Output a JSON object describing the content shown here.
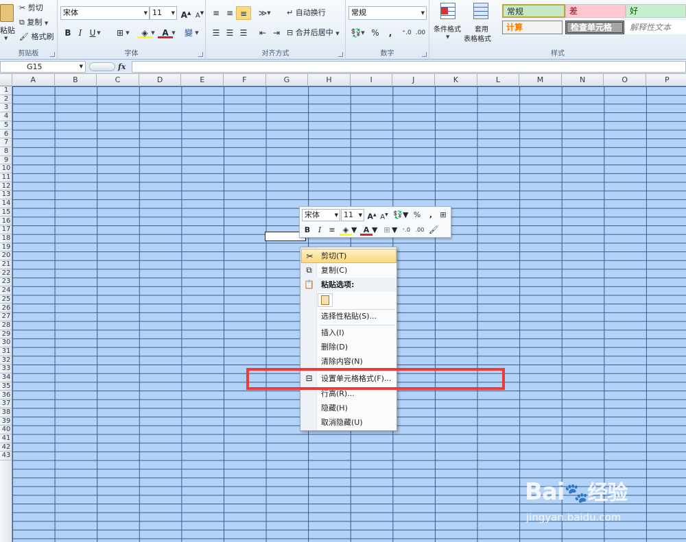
{
  "clipboard": {
    "paste_label": "粘贴",
    "cut_label": "剪切",
    "copy_label": "复制",
    "format_painter_label": "格式刷",
    "group_title": "剪贴板"
  },
  "font": {
    "font_name": "宋体",
    "font_size": "11",
    "group_title": "字体"
  },
  "alignment": {
    "wrap_text_label": "自动换行",
    "merge_center_label": "合并后居中",
    "group_title": "对齐方式"
  },
  "number": {
    "format_value": "常规",
    "group_title": "数字"
  },
  "styles": {
    "conditional_format_label": "条件格式",
    "table_format_label_1": "套用",
    "table_format_label_2": "表格格式",
    "group_title": "样式",
    "gallery": [
      {
        "label": "常规"
      },
      {
        "label": "差"
      },
      {
        "label": "好"
      },
      {
        "label": "计算"
      },
      {
        "label": "检查单元格"
      },
      {
        "label": "解释性文本"
      }
    ]
  },
  "formula_bar": {
    "name_box": "G15",
    "fx_label": "fx"
  },
  "columns": [
    "A",
    "B",
    "C",
    "D",
    "E",
    "F",
    "G",
    "H",
    "I",
    "J",
    "K",
    "L",
    "M",
    "N",
    "O",
    "P"
  ],
  "rows": [
    "1",
    "2",
    "3",
    "4",
    "5",
    "6",
    "7",
    "8",
    "9",
    "10",
    "11",
    "12",
    "13",
    "14",
    "15",
    "16",
    "17",
    "18",
    "19",
    "20",
    "21",
    "22",
    "23",
    "24",
    "25",
    "26",
    "27",
    "28",
    "29",
    "30",
    "31",
    "32",
    "33",
    "34",
    "35",
    "36",
    "37",
    "38",
    "39",
    "40",
    "41",
    "42",
    "43"
  ],
  "mini_toolbar": {
    "font_name": "宋体",
    "font_size": "11",
    "percent": "%",
    "comma": ","
  },
  "context_menu": {
    "items": [
      {
        "label": "剪切(T)",
        "icon": "scissors-icon"
      },
      {
        "label": "复制(C)",
        "icon": "copy-icon"
      },
      {
        "label": "粘贴选项:",
        "icon": "paste-icon"
      },
      {
        "label": "选择性粘贴(S)..."
      },
      {
        "label": "插入(I)"
      },
      {
        "label": "删除(D)"
      },
      {
        "label": "清除内容(N)"
      },
      {
        "label": "设置单元格格式(F)...",
        "icon": "format-cells-icon"
      },
      {
        "label": "行高(R)..."
      },
      {
        "label": "隐藏(H)"
      },
      {
        "label": "取消隐藏(U)"
      }
    ]
  },
  "watermark": {
    "brand": "Bai",
    "brand_cn": "经验",
    "url": "jingyan.baidu.com"
  }
}
